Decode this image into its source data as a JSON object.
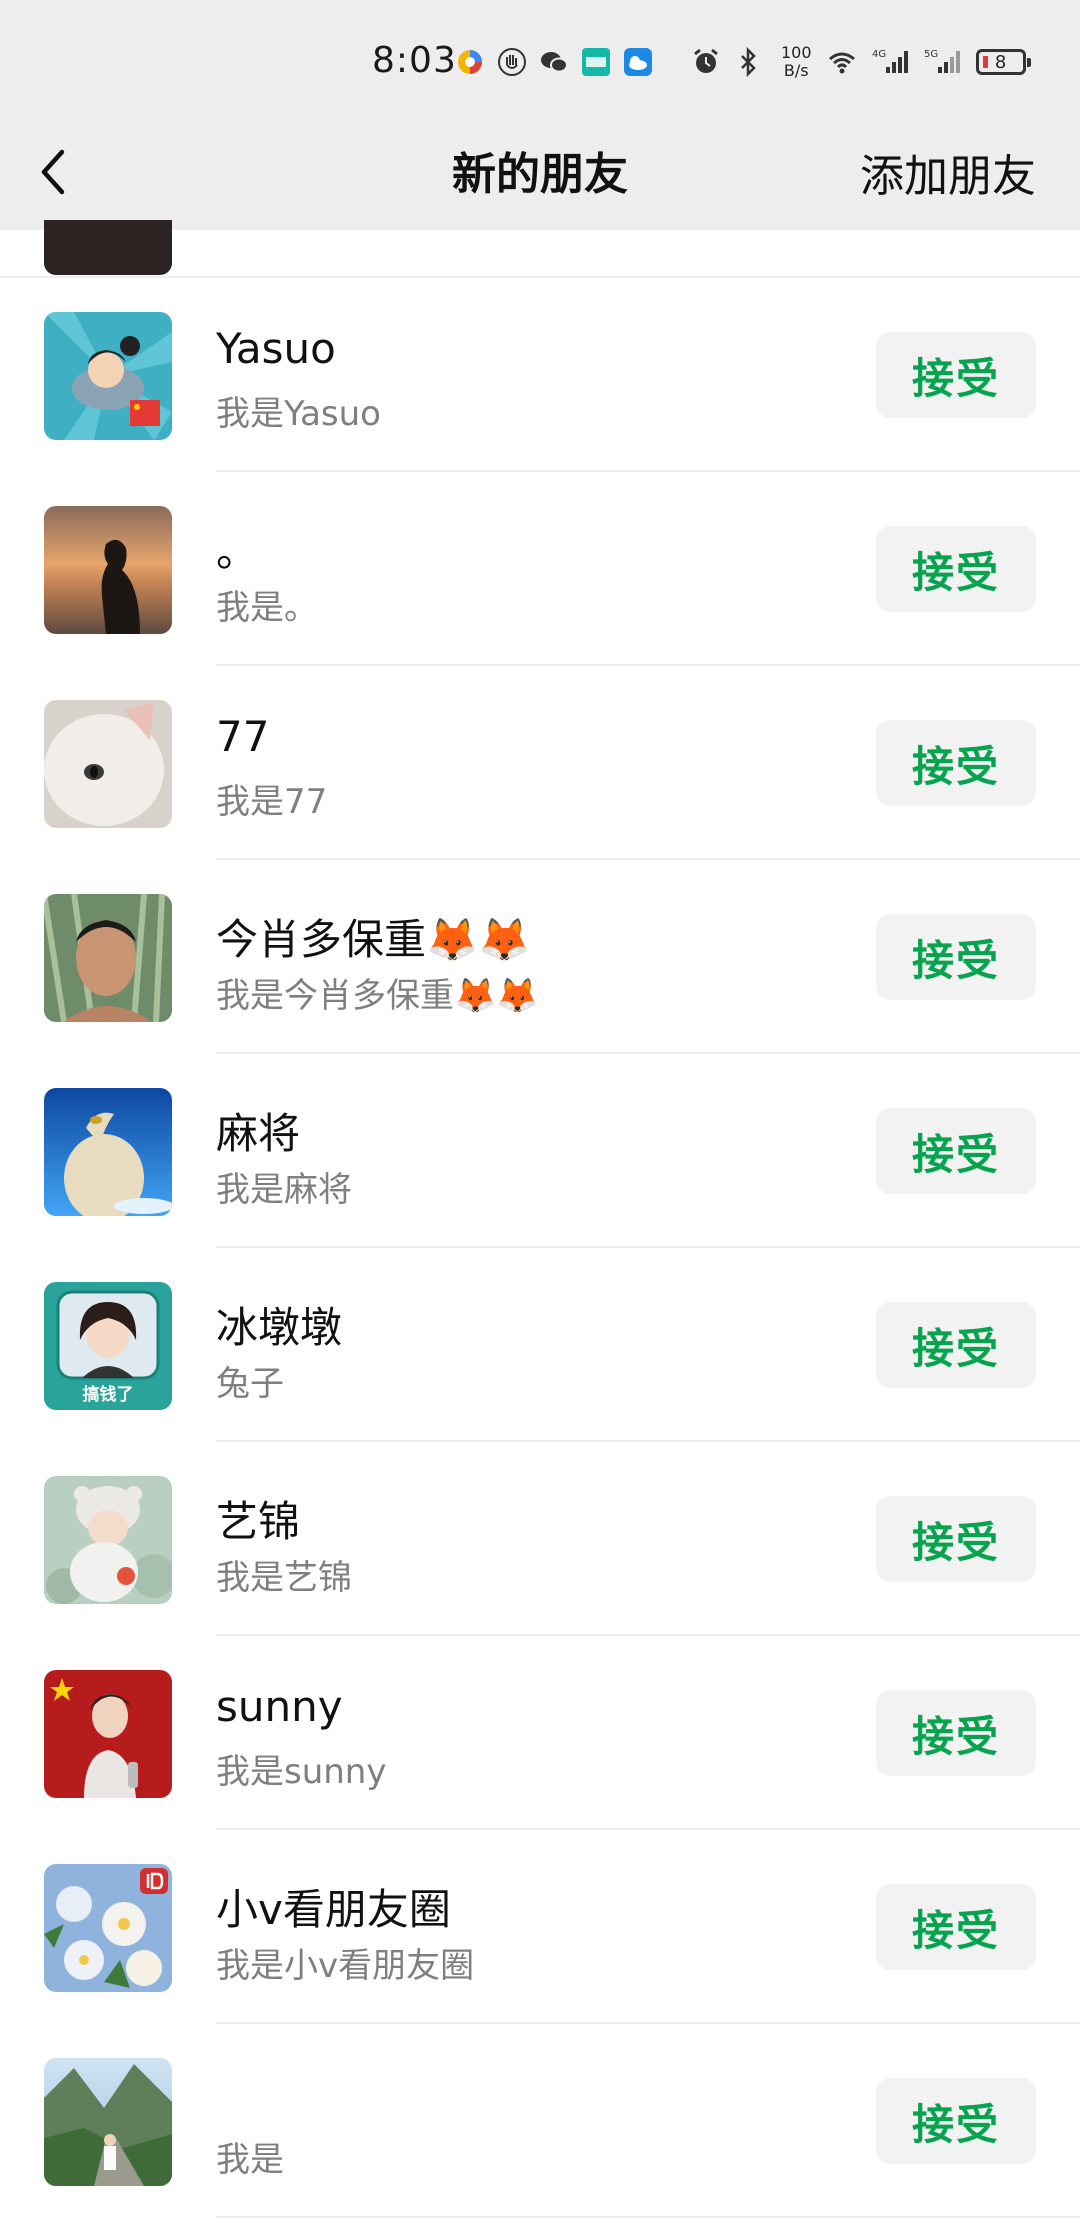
{
  "status_bar": {
    "time": "8:03",
    "network_speed_value": "100",
    "network_speed_unit": "B/s",
    "signal_4g": "4G",
    "signal_5g": "5G",
    "battery": "8",
    "icons": [
      "app-icon",
      "hand-icon",
      "wechat-icon",
      "boss-icon",
      "weather-icon",
      "alarm-icon",
      "bluetooth-icon",
      "wifi-icon",
      "signal-icon",
      "battery-icon"
    ]
  },
  "navbar": {
    "title": "新的朋友",
    "add_label": "添加朋友"
  },
  "accept_label": "接受",
  "requests": [
    {
      "name": "Yasuo",
      "message": "我是Yasuo"
    },
    {
      "name": "。",
      "message": "我是。"
    },
    {
      "name": "77",
      "message": "我是77"
    },
    {
      "name": "今肖多保重🦊🦊",
      "message": "我是今肖多保重🦊🦊"
    },
    {
      "name": "麻将",
      "message": "我是麻将"
    },
    {
      "name": "冰墩墩",
      "message": "兔子",
      "avatar_text": "搞钱了"
    },
    {
      "name": "艺锦",
      "message": "我是艺锦"
    },
    {
      "name": "sunny",
      "message": "我是sunny"
    },
    {
      "name": "小v看朋友圈",
      "message": "我是小v看朋友圈"
    },
    {
      "name": "",
      "message": "我是"
    }
  ],
  "colors": {
    "accent": "#07a34e",
    "header_bg": "#ededed",
    "button_bg": "#f2f2f2"
  }
}
